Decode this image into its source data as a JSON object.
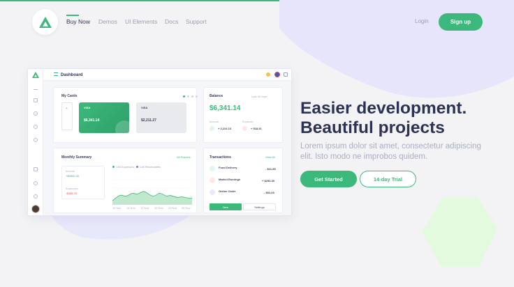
{
  "nav": {
    "links": [
      "Buy Now",
      "Demos",
      "UI Elements",
      "Docs",
      "Support"
    ],
    "login": "Login",
    "signup": "Sign up"
  },
  "hero": {
    "title_line1": "Easier development.",
    "title_line2": "Beautiful projects",
    "subtitle": "Lorem ipsum dolor sit amet, consectetur adipiscing elit. Isto modo ne improbos quidem.",
    "cta_primary": "Get Started",
    "cta_secondary": "14-day Trial"
  },
  "colors": {
    "accent": "#3cb97a",
    "heading": "#2c3253",
    "muted": "#a9aec2"
  },
  "dashboard": {
    "title": "Dashboard",
    "my_cards": {
      "title": "My Cards",
      "card1": {
        "brand": "VISA",
        "amount": "$6,341.14"
      },
      "card2": {
        "brand": "VISA",
        "amount": "$2,211.27"
      }
    },
    "balance": {
      "title": "Balance",
      "filter": "Last 30 days",
      "amount": "$6,341.14",
      "income_label": "Income",
      "income_value": "+ 2,224.13",
      "expense_label": "Expense",
      "expense_value": "+ 518.41"
    },
    "monthly": {
      "title": "Monthly Summary",
      "link": "All Reports",
      "legend": [
        "Cell Expenses",
        "Cell Receivables"
      ],
      "income_label": "Income",
      "income_value": "+$5850.00",
      "expenses_label": "Expenses",
      "expenses_value": "-$265.75",
      "x_labels": [
        "11 Nov",
        "14 Nov",
        "17 Nov",
        "20 Nov",
        "23 Nov",
        "26 Nov"
      ]
    },
    "transactions": {
      "title": "Transactions",
      "link": "View All",
      "items": [
        {
          "name": "Food Delivery",
          "amount": "- $41.85"
        },
        {
          "name": "Market Earnings",
          "amount": "+ $253.39"
        },
        {
          "name": "Online Order",
          "amount": "- $92.05"
        }
      ],
      "btn_new": "New",
      "btn_settings": "Settings"
    }
  }
}
